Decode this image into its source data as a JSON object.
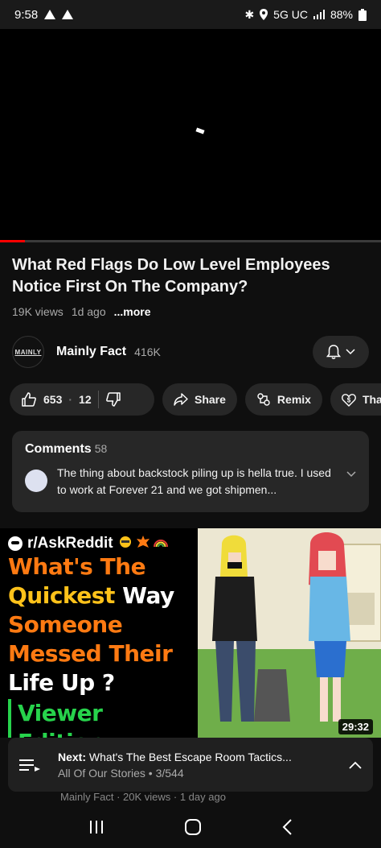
{
  "status_bar": {
    "time": "9:58",
    "network": "5G UC",
    "battery": "88%"
  },
  "player": {
    "progress_fraction": 0.065
  },
  "video": {
    "title": "What Red Flags Do Low Level Employees Notice First On The Company?",
    "views": "19K views",
    "age": "1d ago",
    "more": "...more"
  },
  "channel": {
    "avatar_text": "MAINLY",
    "name": "Mainly Fact",
    "subscribers": "416K"
  },
  "actions": {
    "likes": "653",
    "dislikes": "12",
    "share": "Share",
    "remix": "Remix",
    "thanks": "Thanks"
  },
  "comments": {
    "title": "Comments",
    "count": "58",
    "top_comment": "The thing about backstock piling up is hella true. I used to work at Forever 21 and we got shipmen..."
  },
  "thumbnail": {
    "subreddit": "r/AskReddit",
    "lines": [
      "What's The",
      "Quickest Way",
      "Someone",
      "Messed Their",
      "Life Up ?"
    ],
    "edition": "Viewer Edition",
    "duration": "29:32"
  },
  "behind_meta": "Mainly Fact · 20K views · 1 day ago",
  "next_up": {
    "label": "Next:",
    "title": "What's The Best Escape Room Tactics...",
    "playlist": "All Of Our Stories • 3/544"
  },
  "colors": {
    "accent": "#ff0000",
    "orange": "#ff7a12",
    "yellow": "#ffc21a",
    "green": "#27d34c"
  }
}
